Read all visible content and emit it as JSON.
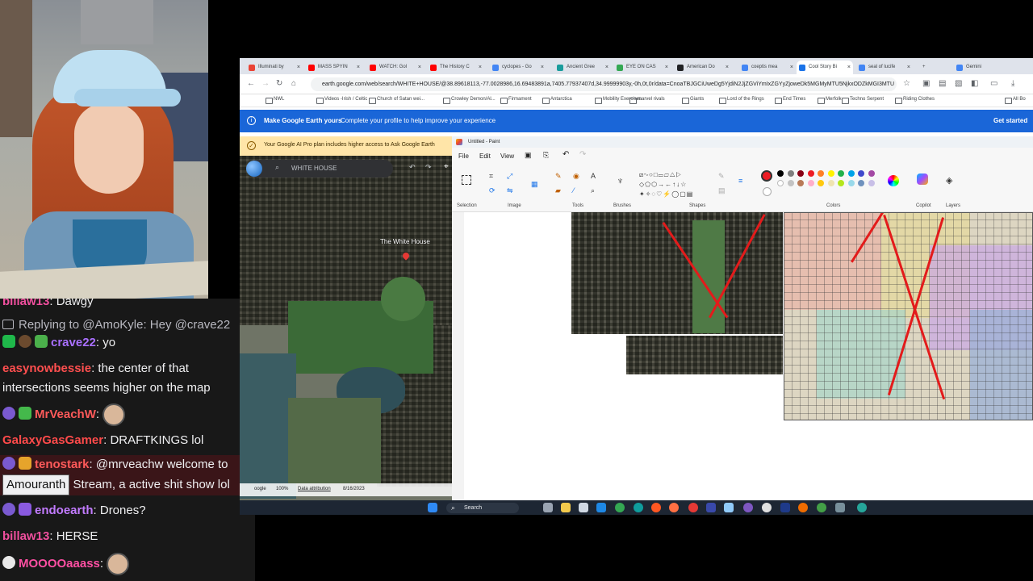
{
  "chat": [
    {
      "user": "billaw13",
      "text": "Dawgy",
      "user_color": "#f04f9e"
    },
    {
      "reply": "Replying to @AmoKyle: Hey @crave22"
    },
    {
      "user": "crave22",
      "text": "yo",
      "user_color": "#a970ff"
    },
    {
      "user": "easynowbessie",
      "text": "the center of that intersections seems higher on the map",
      "text2": "intersections seems higher on the map",
      "text1": "the center of that",
      "user_color": "#ff4f4f"
    },
    {
      "user": "MrVeachW",
      "text": "",
      "user_color": "#ff5a5a"
    },
    {
      "user": "GalaxyGasGamer",
      "text": "DRAFTKINGS lol",
      "user_color": "#ff4a4a"
    },
    {
      "user": "tenostark",
      "text1": "@mrveachw welcome to",
      "name_box": "Amouranth",
      "text2": "Stream, a active shit show lol",
      "user_color": "#ff5a5a"
    },
    {
      "user": "endoearth",
      "text": "Drones?",
      "user_color": "#c27bff"
    },
    {
      "user": "billaw13",
      "text": "HERSE",
      "user_color": "#f04f9e"
    },
    {
      "user": "MOOOOaaass",
      "text": "",
      "user_color": "#ff4fa3"
    }
  ],
  "browser": {
    "tabs": [
      {
        "label": "Illuminati by",
        "color": "#ea4335"
      },
      {
        "label": "MASS SPYIN",
        "color": "#ff0000"
      },
      {
        "label": "WATCH: Gol",
        "color": "#ff0000"
      },
      {
        "label": "The History C",
        "color": "#ff0000"
      },
      {
        "label": "cyclopes - Go",
        "color": "#4285f4"
      },
      {
        "label": "Ancient Gree",
        "color": "#1a9c9c"
      },
      {
        "label": "EYE ON CAS",
        "color": "#34a853"
      },
      {
        "label": "American Do",
        "color": "#202124"
      },
      {
        "label": "coeptis mea",
        "color": "#4285f4"
      },
      {
        "label": "Cool Story Bi",
        "color": "#1a73e8"
      },
      {
        "label": "seal of lucife",
        "color": "#4285f4"
      },
      {
        "label": "Gemini",
        "color": "#4285f4"
      }
    ],
    "url": "earth.google.com/web/search/WHITE+HOUSE/@38.89618113,-77.0028986,16.69483891a,7405.77937407d,34.99999903y,-0h,0t,0r/data=CnoaTBJGCiUweDg5YjdiN2JjZGViYmIxZGYyZjoweDk5MGMyMTU5NjkxODZkMGI3MTU",
    "bookmarks": [
      "NWL",
      "Videos -Irish / Celtic",
      "Church of Satan wei...",
      "Crowley Demon/Al...",
      "Firmament",
      "Antarctica",
      "Mobility Exercises",
      "marvel rivals",
      "Giants",
      "Lord of the Rings",
      "End Times",
      "Merfolk",
      "Techno Serpent",
      "Riding Clothes",
      "All Bo"
    ],
    "blue_bar": {
      "title": "Make Google Earth yours",
      "text": "Complete your profile to help improve your experience",
      "action": "Get started"
    },
    "yellow_bar": "Your Google AI Pro plan includes higher access to Ask Google Earth"
  },
  "earth": {
    "search_placeholder": "WHITE HOUSE",
    "place_label": "The White House",
    "footer_brand": "oogle",
    "footer_zoom": "100%",
    "footer_attr": "Data attribution",
    "footer_date": "8/16/2023"
  },
  "paint": {
    "title": "Untitled - Paint",
    "menu": [
      "File",
      "Edit",
      "View"
    ],
    "groups": [
      "Selection",
      "Image",
      "Tools",
      "Brushes",
      "Shapes",
      "Colors",
      "Copilot",
      "Layers"
    ],
    "swatches": [
      "#000000",
      "#7f7f7f",
      "#880015",
      "#ed1c24",
      "#ff7f27",
      "#fff200",
      "#22b14c",
      "#00a2e8",
      "#3f48cc",
      "#a349a4",
      "#ffffff",
      "#c3c3c3",
      "#b97a57",
      "#ffaec9",
      "#ffc90e",
      "#efe4b0",
      "#b5e61d",
      "#99d9ea",
      "#7092be",
      "#c8bfe7"
    ],
    "primary_color": "#ed1c24",
    "secondary_color": "#ffffff"
  },
  "taskbar": {
    "search_label": "Search"
  }
}
